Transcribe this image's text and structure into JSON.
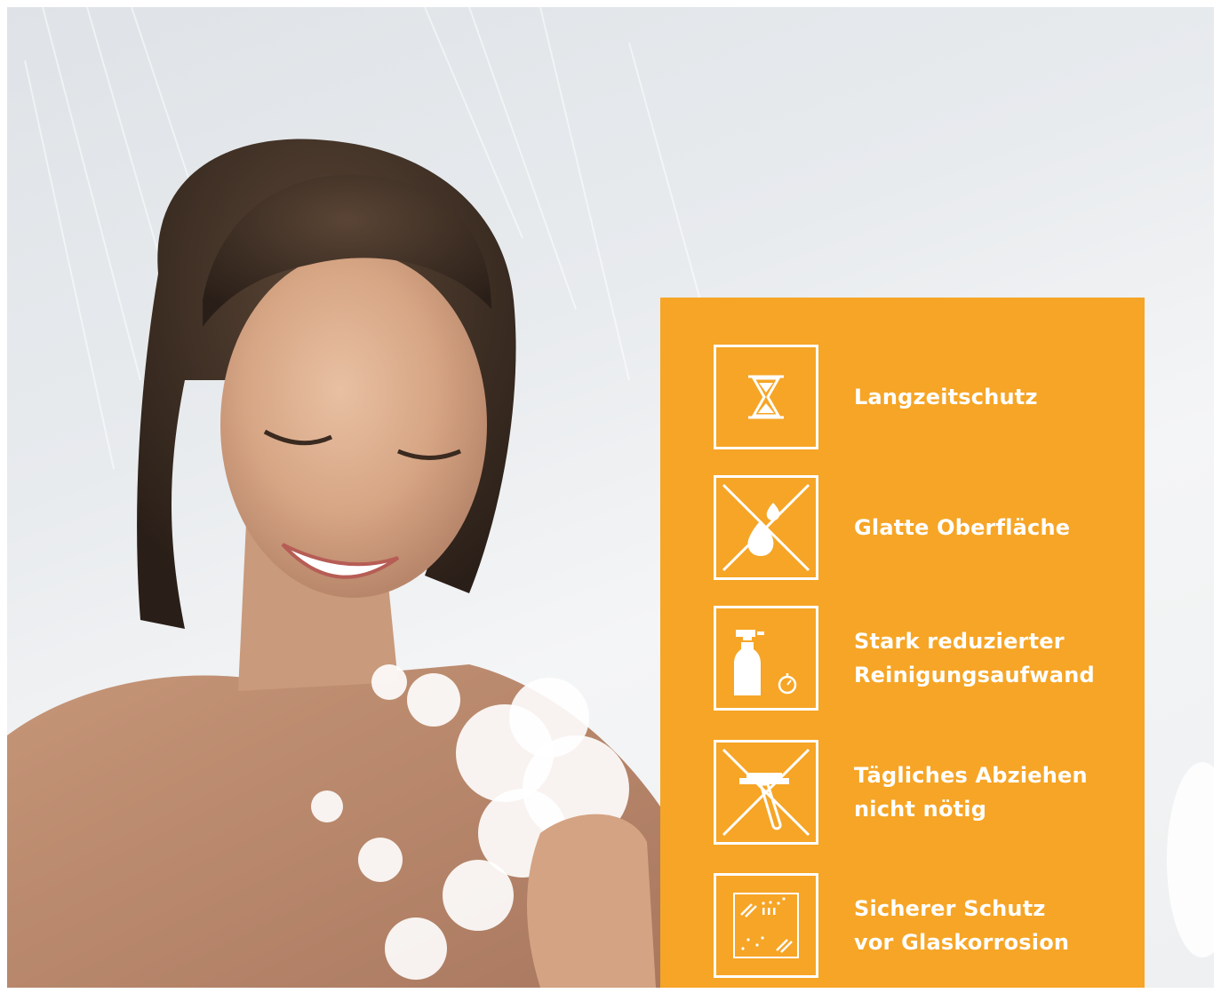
{
  "features": [
    {
      "icon": "hourglass-icon",
      "lines": [
        "Langzeitschutz"
      ]
    },
    {
      "icon": "crossed-out-water-drops-icon",
      "lines": [
        "Glatte Oberfläche"
      ]
    },
    {
      "icon": "spray-bottle-timer-icon",
      "lines": [
        "Stark reduzierter",
        "Reinigungsaufwand"
      ]
    },
    {
      "icon": "crossed-out-squeegee-icon",
      "lines": [
        "Tägliches Abziehen",
        "nicht nötig"
      ]
    },
    {
      "icon": "glass-pane-icon",
      "lines": [
        "Sicherer Schutz",
        "vor Glaskorrosion"
      ]
    }
  ],
  "colors": {
    "panel": "#f6a526",
    "icon_stroke": "#ffffff",
    "text": "#ffffff"
  }
}
